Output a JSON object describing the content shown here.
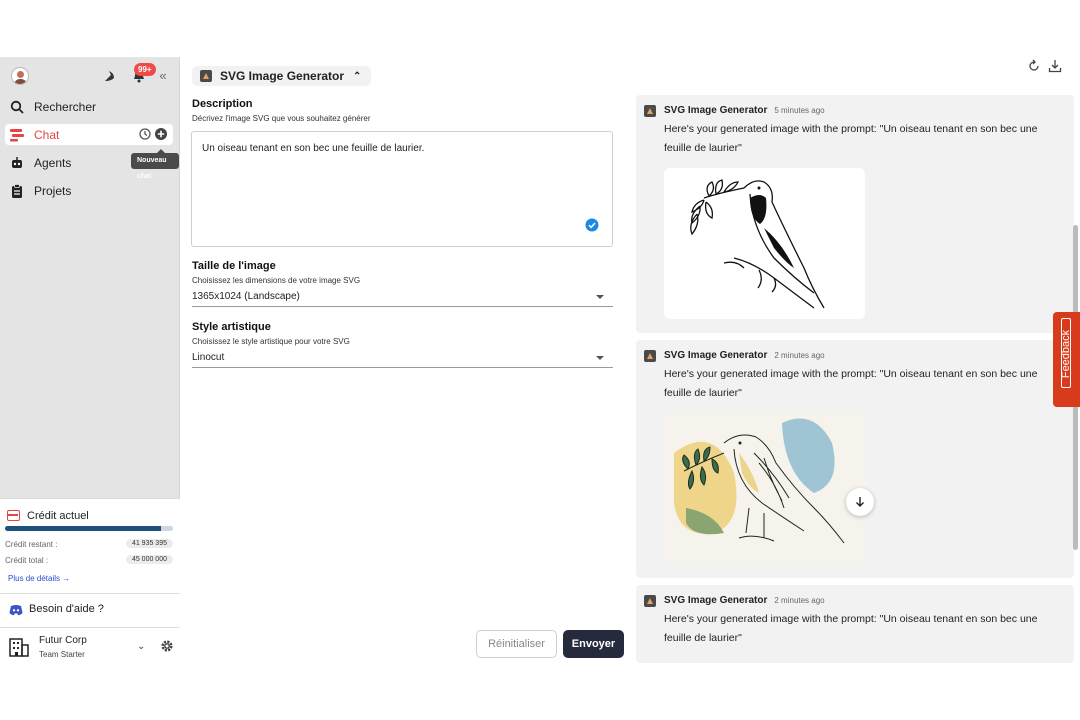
{
  "sidebar": {
    "notification_count": "99+",
    "nav": [
      {
        "label": "Rechercher",
        "icon": "search-icon"
      },
      {
        "label": "Chat",
        "icon": "chat-icon",
        "active": true
      },
      {
        "label": "Agents",
        "icon": "robot-icon"
      },
      {
        "label": "Projets",
        "icon": "clipboard-icon"
      }
    ],
    "tooltip": "Nouveau chat",
    "credit": {
      "title": "Crédit actuel",
      "remaining_label": "Crédit restant :",
      "remaining_value": "41 935 395",
      "total_label": "Crédit total :",
      "total_value": "45 000 000",
      "usage_fraction": 0.93,
      "more_label": "Plus de détails"
    },
    "help_label": "Besoin d'aide ?",
    "org": {
      "name": "Futur Corp",
      "plan": "Team Starter"
    }
  },
  "form": {
    "agent_name": "SVG Image Generator",
    "description": {
      "label": "Description",
      "help": "Décrivez l'image SVG que vous souhaitez générer",
      "value": "Un oiseau tenant en son bec une feuille de laurier."
    },
    "size": {
      "label": "Taille de l'image",
      "help": "Choisissez les dimensions de votre image SVG",
      "value": "1365x1024 (Landscape)"
    },
    "style": {
      "label": "Style artistique",
      "help": "Choisissez le style artistique pour votre SVG",
      "value": "Linocut"
    },
    "reset_label": "Réinitialiser",
    "send_label": "Envoyer"
  },
  "results": [
    {
      "name": "SVG Image Generator",
      "time": "5 minutes ago",
      "message": "Here's your generated image with the prompt: \"Un oiseau tenant en son bec une feuille de laurier\""
    },
    {
      "name": "SVG Image Generator",
      "time": "2 minutes ago",
      "message": "Here's your generated image with the prompt: \"Un oiseau tenant en son bec une feuille de laurier\""
    },
    {
      "name": "SVG Image Generator",
      "time": "2 minutes ago",
      "message": "Here's your generated image with the prompt: \"Un oiseau tenant en son bec une feuille de laurier\""
    }
  ],
  "feedback_label": "Feedback",
  "colors": {
    "accent": "#e64545",
    "send_button": "#262a3d",
    "feedback": "#d83a1c",
    "credit_bar": "#1f4f7c"
  }
}
